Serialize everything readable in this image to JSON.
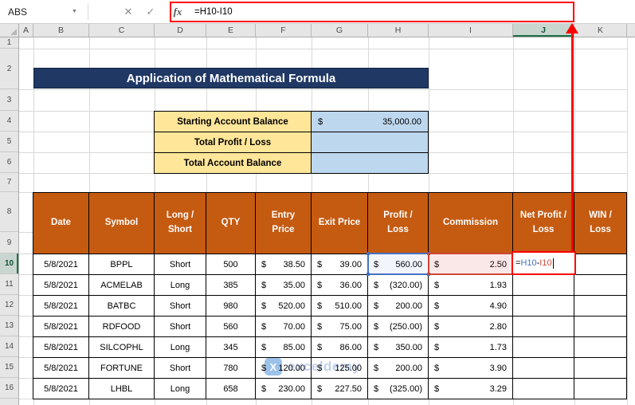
{
  "formula_bar": {
    "name_box_value": "ABS",
    "dropdown_icon": "▼",
    "cancel_icon": "✕",
    "enter_icon": "✓",
    "fx_label": "fx",
    "formula_text": "=H10-I10"
  },
  "sheet": {
    "col_headers": [
      "A",
      "B",
      "C",
      "D",
      "E",
      "F",
      "G",
      "H",
      "I",
      "J",
      "K"
    ],
    "row_headers": [
      "1",
      "2",
      "3",
      "4",
      "5",
      "6",
      "7",
      "8",
      "9",
      "10",
      "11",
      "12",
      "13",
      "14",
      "15",
      "16"
    ]
  },
  "banner": {
    "title": "Application of Mathematical Formula"
  },
  "summary": {
    "rows": [
      {
        "label": "Starting Account Balance",
        "currency": "$",
        "value": "35,000.00"
      },
      {
        "label": "Total Profit / Loss",
        "currency": "",
        "value": ""
      },
      {
        "label": "Total Account Balance",
        "currency": "",
        "value": ""
      }
    ]
  },
  "trade_table": {
    "currency": "$",
    "headers": [
      "Date",
      "Symbol",
      "Long / Short",
      "QTY",
      "Entry Price",
      "Exit Price",
      "Profit / Loss",
      "Commission",
      "Net Profit / Loss",
      "WIN / Loss"
    ],
    "rows": [
      {
        "date": "5/8/2021",
        "symbol": "BPPL",
        "position": "Short",
        "qty": "500",
        "entry": "38.50",
        "exit": "39.00",
        "profit_loss": "560.00",
        "commission": "2.50"
      },
      {
        "date": "5/8/2021",
        "symbol": "ACMELAB",
        "position": "Long",
        "qty": "385",
        "entry": "35.00",
        "exit": "36.00",
        "profit_loss": "(320.00)",
        "commission": "1.93"
      },
      {
        "date": "5/8/2021",
        "symbol": "BATBC",
        "position": "Short",
        "qty": "980",
        "entry": "520.00",
        "exit": "510.00",
        "profit_loss": "200.00",
        "commission": "4.90"
      },
      {
        "date": "5/8/2021",
        "symbol": "RDFOOD",
        "position": "Short",
        "qty": "560",
        "entry": "70.00",
        "exit": "75.00",
        "profit_loss": "(250.00)",
        "commission": "2.80"
      },
      {
        "date": "5/8/2021",
        "symbol": "SILCOPHL",
        "position": "Long",
        "qty": "345",
        "entry": "85.00",
        "exit": "86.00",
        "profit_loss": "350.00",
        "commission": "1.73"
      },
      {
        "date": "5/8/2021",
        "symbol": "FORTUNE",
        "position": "Short",
        "qty": "780",
        "entry": "120.00",
        "exit": "125.00",
        "profit_loss": "200.00",
        "commission": "3.90"
      },
      {
        "date": "5/8/2021",
        "symbol": "LHBL",
        "position": "Long",
        "qty": "658",
        "entry": "230.00",
        "exit": "227.50",
        "profit_loss": "(325.00)",
        "commission": "3.29"
      }
    ]
  },
  "editing_cell": {
    "eq": "=",
    "ref1": "H10",
    "operator": "-",
    "ref2": "I10"
  },
  "watermark": {
    "text": "exceldemy",
    "logo_glyph": "X"
  },
  "colors": {
    "banner-bg": "#1F3864",
    "summary-label-bg": "#FFE699",
    "summary-value-bg": "#BDD7EE",
    "table-header-bg": "#C55A11",
    "annotation-red": "#FE0000",
    "ref-blue": "#4472C4",
    "ref-red": "#D04437",
    "select-green": "#1E7145"
  }
}
